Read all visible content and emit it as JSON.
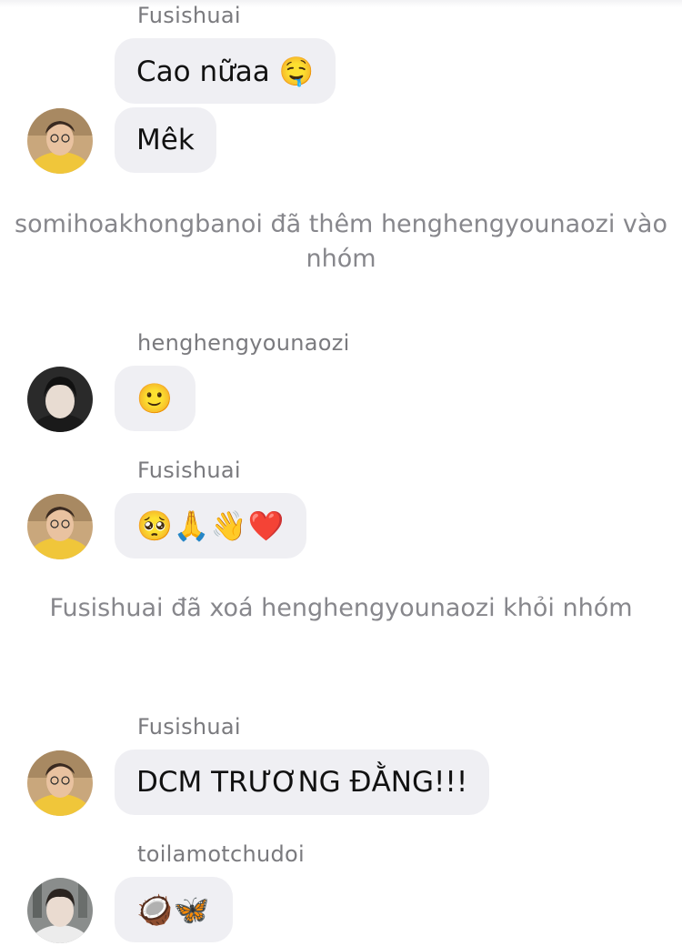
{
  "messages": [
    {
      "sender": "Fusishuai",
      "text": "Cao nữaa 🤤"
    },
    {
      "text": "Mêk"
    },
    {
      "system": "somihoakhongbanoi đã thêm henghengyounaozi vào nhóm"
    },
    {
      "sender": "henghengyounaozi",
      "text": "🙂"
    },
    {
      "sender": "Fusishuai",
      "text": "🥺🙏👋❤️"
    },
    {
      "system": "Fusishuai đã xoá henghengyounaozi khỏi nhóm"
    },
    {
      "sender": "Fusishuai",
      "text": "DCM TRƯƠNG ĐẰNG!!!"
    },
    {
      "sender": "toilamotchudoi",
      "text": "🥥🦋"
    }
  ],
  "colors": {
    "bubble": "#efeff3",
    "sender_text": "#7a7a7e",
    "system_text": "#87878c",
    "avatar_fusishuai": "#f0c63a"
  }
}
